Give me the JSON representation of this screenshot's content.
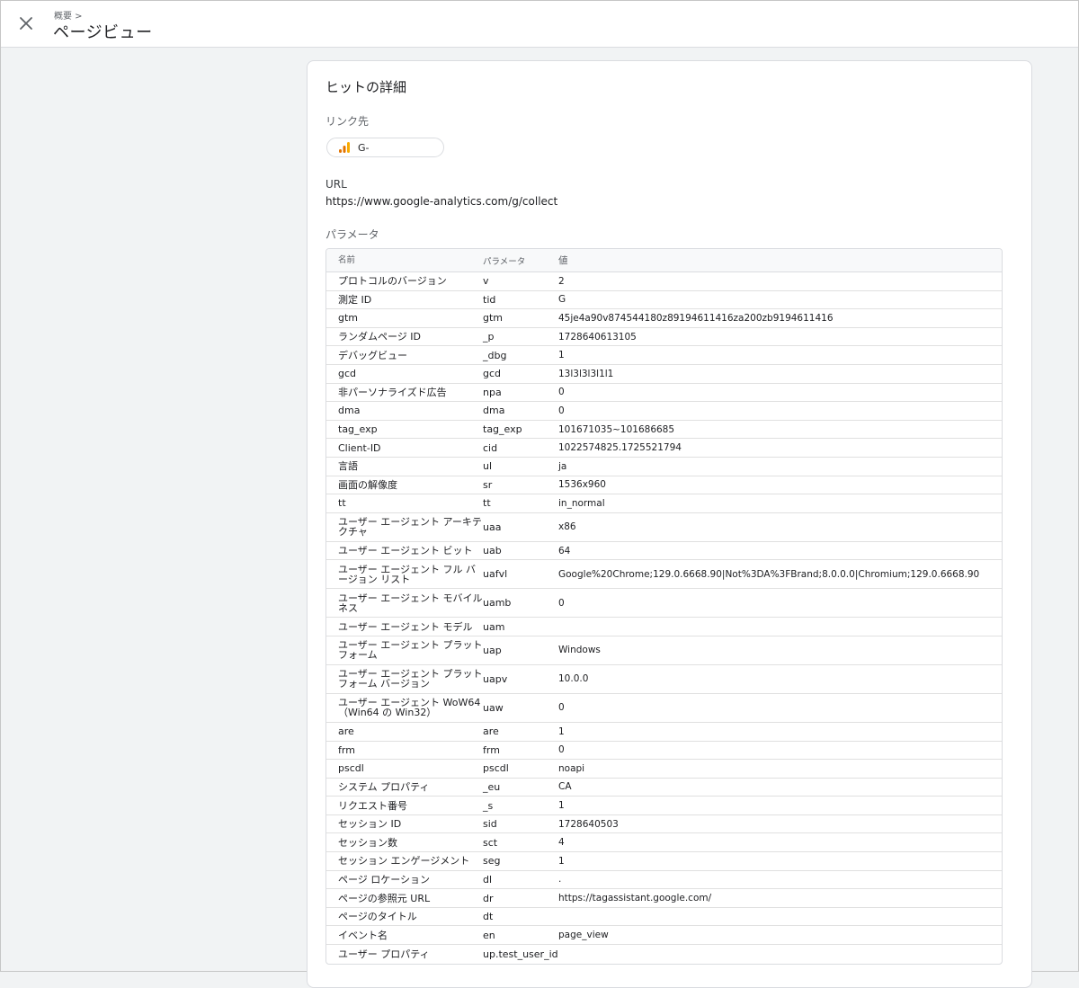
{
  "header": {
    "breadcrumb": "概要 >",
    "title": "ページビュー",
    "close_icon": "close-icon"
  },
  "card": {
    "title": "ヒットの詳細",
    "link_label": "リンク先",
    "chip_label": "G-",
    "chip_icon": "analytics-bar-icon",
    "chip_icon_color": "#f9ab00",
    "url_label": "URL",
    "url_value": "https://www.google-analytics.com/g/collect",
    "params_label": "パラメータ"
  },
  "table": {
    "headers": [
      "名前",
      "パラメータ",
      "値"
    ],
    "rows": [
      {
        "name": "プロトコルのバージョン",
        "param": "v",
        "value": "2"
      },
      {
        "name": "測定 ID",
        "param": "tid",
        "value": "G"
      },
      {
        "name": "gtm",
        "param": "gtm",
        "value": "45je4a90v874544180z89194611416za200zb9194611416"
      },
      {
        "name": "ランダムページ ID",
        "param": "_p",
        "value": "1728640613105"
      },
      {
        "name": "デバッグビュー",
        "param": "_dbg",
        "value": "1"
      },
      {
        "name": "gcd",
        "param": "gcd",
        "value": "13l3l3l3l1l1"
      },
      {
        "name": "非パーソナライズド広告",
        "param": "npa",
        "value": "0"
      },
      {
        "name": "dma",
        "param": "dma",
        "value": "0"
      },
      {
        "name": "tag_exp",
        "param": "tag_exp",
        "value": "101671035~101686685"
      },
      {
        "name": "Client-ID",
        "param": "cid",
        "value": "1022574825.1725521794"
      },
      {
        "name": "言語",
        "param": "ul",
        "value": "ja"
      },
      {
        "name": "画面の解像度",
        "param": "sr",
        "value": "1536x960"
      },
      {
        "name": "tt",
        "param": "tt",
        "value": "in_normal"
      },
      {
        "name": "ユーザー エージェント アーキテクチャ",
        "param": "uaa",
        "value": "x86"
      },
      {
        "name": "ユーザー エージェント ビット",
        "param": "uab",
        "value": "64"
      },
      {
        "name": "ユーザー エージェント フル バージョン リスト",
        "param": "uafvl",
        "value": "Google%20Chrome;129.0.6668.90|Not%3DA%3FBrand;8.0.0.0|Chromium;129.0.6668.90"
      },
      {
        "name": "ユーザー エージェント モバイルネス",
        "param": "uamb",
        "value": "0"
      },
      {
        "name": "ユーザー エージェント モデル",
        "param": "uam",
        "value": ""
      },
      {
        "name": "ユーザー エージェント プラットフォーム",
        "param": "uap",
        "value": "Windows"
      },
      {
        "name": "ユーザー エージェント プラットフォーム バージョン",
        "param": "uapv",
        "value": "10.0.0"
      },
      {
        "name": "ユーザー エージェント WoW64（Win64 の Win32）",
        "param": "uaw",
        "value": "0"
      },
      {
        "name": "are",
        "param": "are",
        "value": "1"
      },
      {
        "name": "frm",
        "param": "frm",
        "value": "0"
      },
      {
        "name": "pscdl",
        "param": "pscdl",
        "value": "noapi"
      },
      {
        "name": "システム プロパティ",
        "param": "_eu",
        "value": "CA"
      },
      {
        "name": "リクエスト番号",
        "param": "_s",
        "value": "1"
      },
      {
        "name": "セッション ID",
        "param": "sid",
        "value": "1728640503"
      },
      {
        "name": "セッション数",
        "param": "sct",
        "value": "4"
      },
      {
        "name": "セッション エンゲージメント",
        "param": "seg",
        "value": "1"
      },
      {
        "name": "ページ ロケーション",
        "param": "dl",
        "value": "."
      },
      {
        "name": "ページの参照元 URL",
        "param": "dr",
        "value": "https://tagassistant.google.com/"
      },
      {
        "name": "ページのタイトル",
        "param": "dt",
        "value": ""
      },
      {
        "name": "イベント名",
        "param": "en",
        "value": "page_view"
      },
      {
        "name": "ユーザー プロパティ",
        "param": "up.test_user_id",
        "value": ""
      }
    ]
  }
}
